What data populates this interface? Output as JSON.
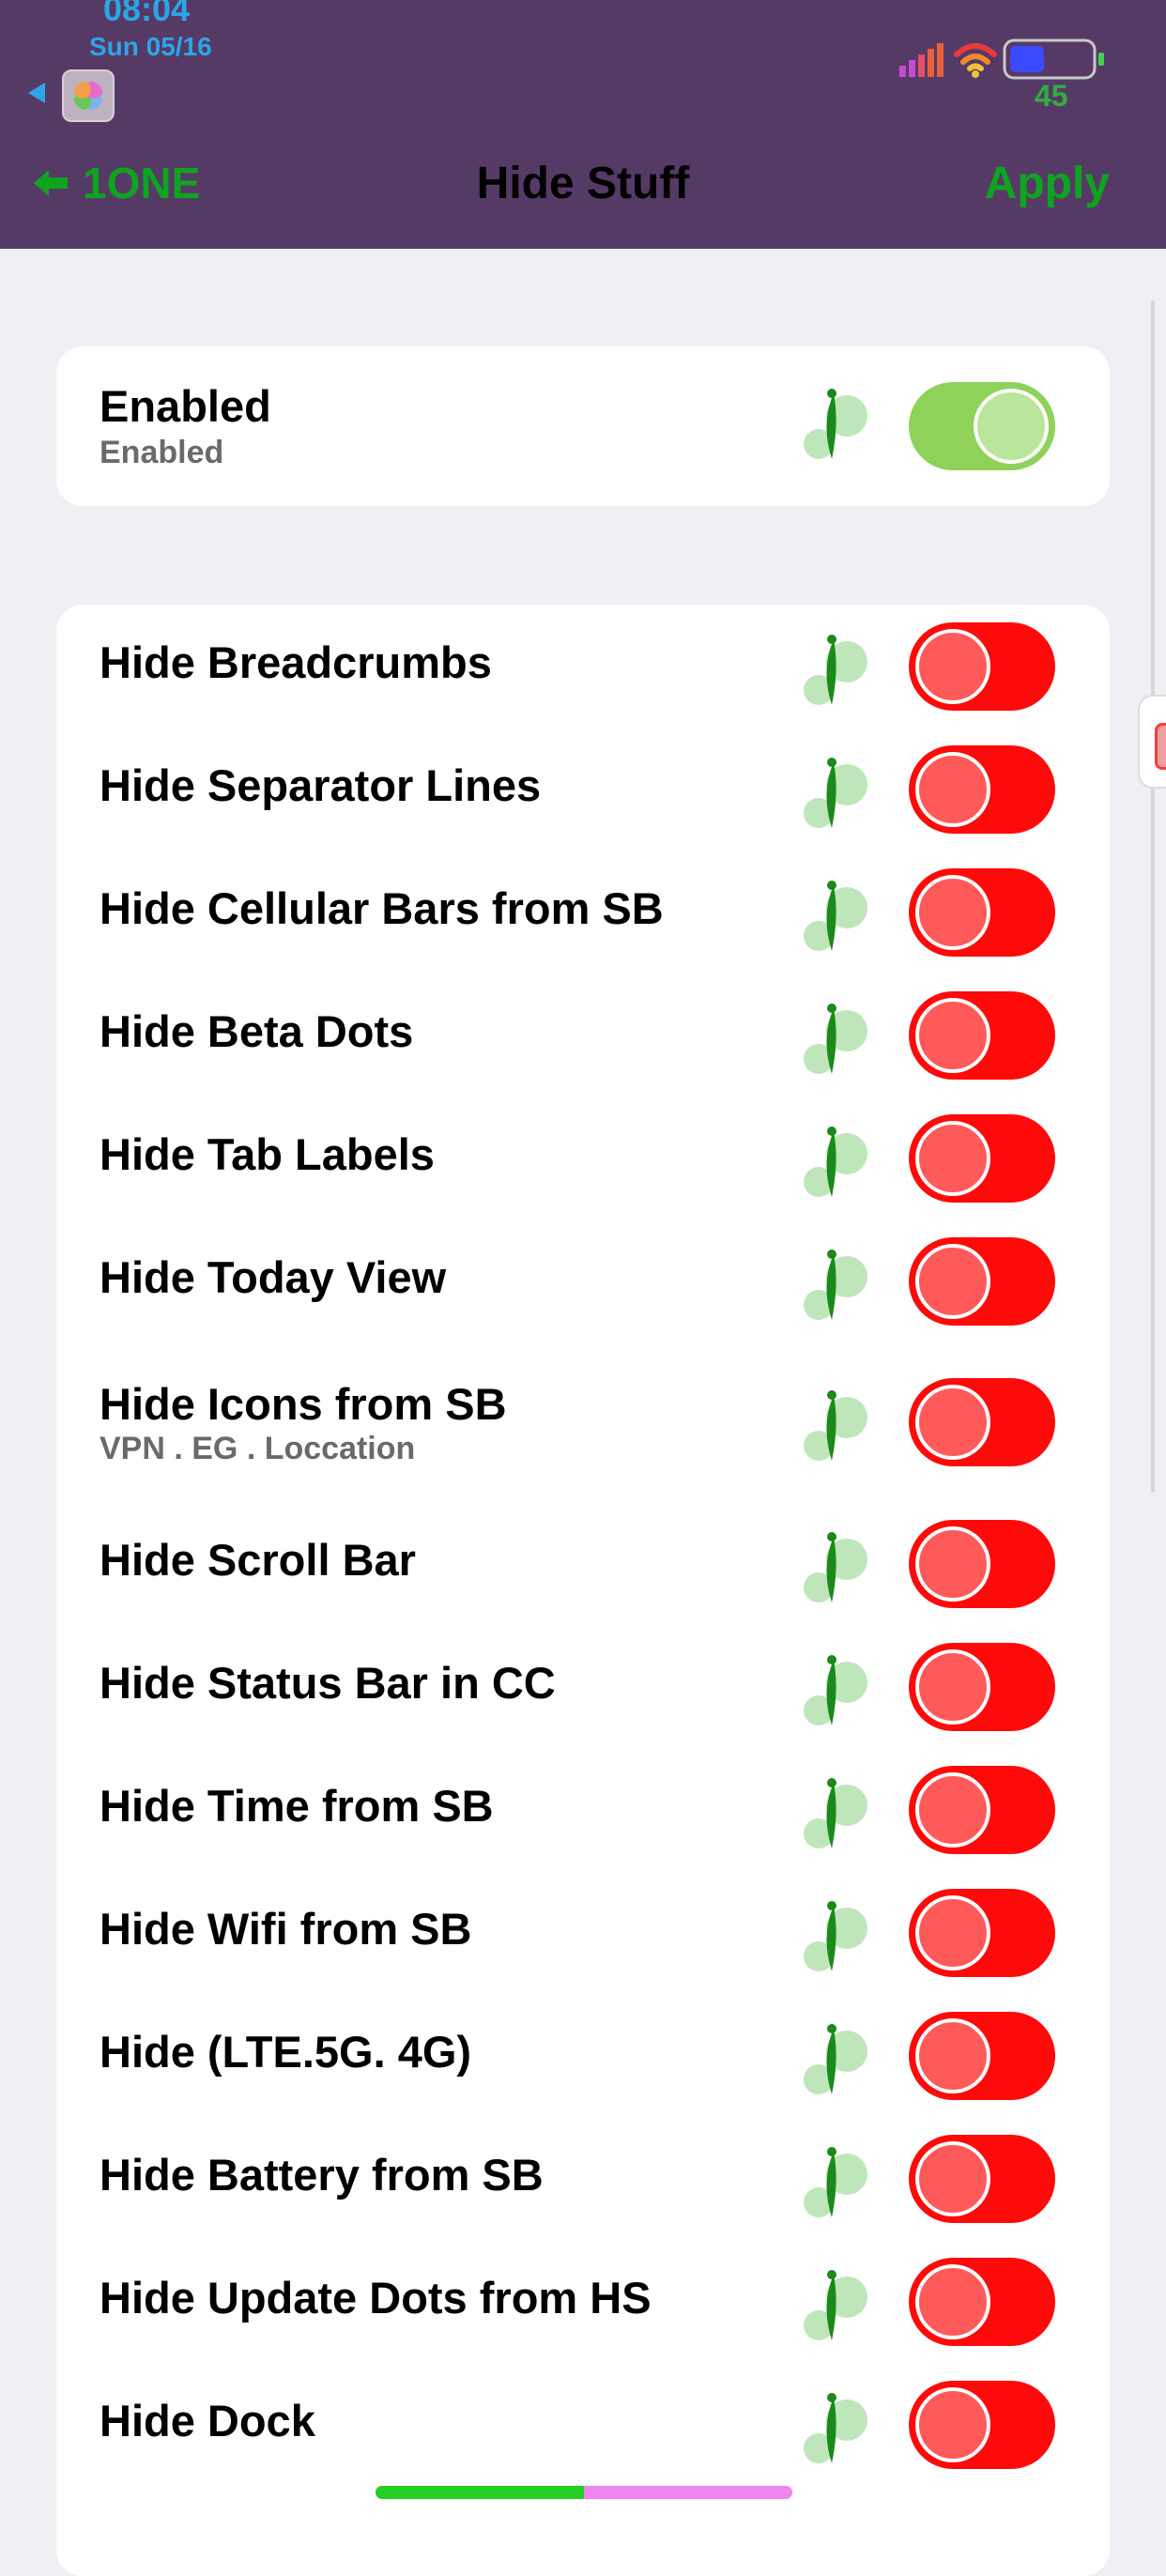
{
  "status_bar": {
    "time": "08:04",
    "date": "Sun 05/16",
    "battery_level": "45"
  },
  "nav": {
    "back_label": "1ONE",
    "title": "Hide Stuff",
    "apply_label": "Apply"
  },
  "enabled_group": {
    "label": "Enabled",
    "sublabel": "Enabled",
    "is_on": true
  },
  "hide_group": {
    "items": [
      {
        "label": "Hide Breadcrumbs",
        "sublabel": "",
        "is_on": false
      },
      {
        "label": "Hide Separator Lines",
        "sublabel": "",
        "is_on": false
      },
      {
        "label": "Hide Cellular Bars from SB",
        "sublabel": "",
        "is_on": false
      },
      {
        "label": "Hide Beta Dots",
        "sublabel": "",
        "is_on": false
      },
      {
        "label": "Hide Tab Labels",
        "sublabel": "",
        "is_on": false
      },
      {
        "label": "Hide Today View",
        "sublabel": "",
        "is_on": false
      },
      {
        "label": "Hide Icons from SB",
        "sublabel": "VPN . EG . Loccation",
        "is_on": false
      },
      {
        "label": "Hide Scroll Bar",
        "sublabel": "",
        "is_on": false
      },
      {
        "label": "Hide Status Bar in CC",
        "sublabel": "",
        "is_on": false
      },
      {
        "label": "Hide Time from SB",
        "sublabel": "",
        "is_on": false
      },
      {
        "label": "Hide Wifi from SB",
        "sublabel": "",
        "is_on": false
      },
      {
        "label": "Hide (LTE.5G. 4G)",
        "sublabel": "",
        "is_on": false
      },
      {
        "label": "Hide Battery from SB",
        "sublabel": "",
        "is_on": false
      },
      {
        "label": "Hide Update Dots from HS",
        "sublabel": "",
        "is_on": false
      },
      {
        "label": "Hide Dock",
        "sublabel": "",
        "is_on": false
      }
    ]
  },
  "icons": {
    "row_icon": "leaf-icon",
    "back": "arrow-left-icon",
    "signal": "cellular-signal-icon",
    "wifi": "wifi-icon",
    "battery": "battery-icon"
  },
  "colors": {
    "header_bg": "#563a66",
    "accent_green": "#0ea41f",
    "toggle_off": "#ff0a0a",
    "toggle_on": "#8fd25a",
    "status_blue": "#2aa6e8"
  },
  "home_indicator": {
    "progress": 0.5
  }
}
